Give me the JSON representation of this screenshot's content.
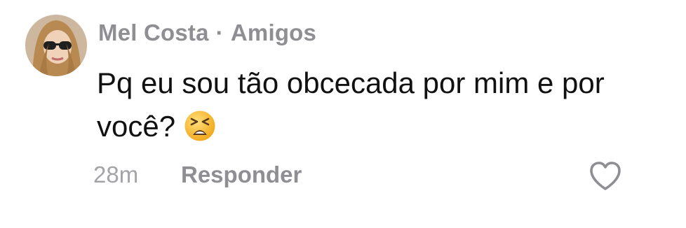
{
  "comment": {
    "author": "Mel Costa",
    "separator": "·",
    "relationship": "Amigos",
    "text": "Pq eu sou tão obcecada por mim e por você?",
    "emoji": "tired-face-emoji",
    "time": "28m",
    "reply_label": "Responder",
    "like_icon": "heart-outline-icon"
  },
  "colors": {
    "muted_text": "#8e8e93",
    "timestamp": "#a3a3a8",
    "body_text": "#111111",
    "emoji_face": "#f7c436"
  }
}
